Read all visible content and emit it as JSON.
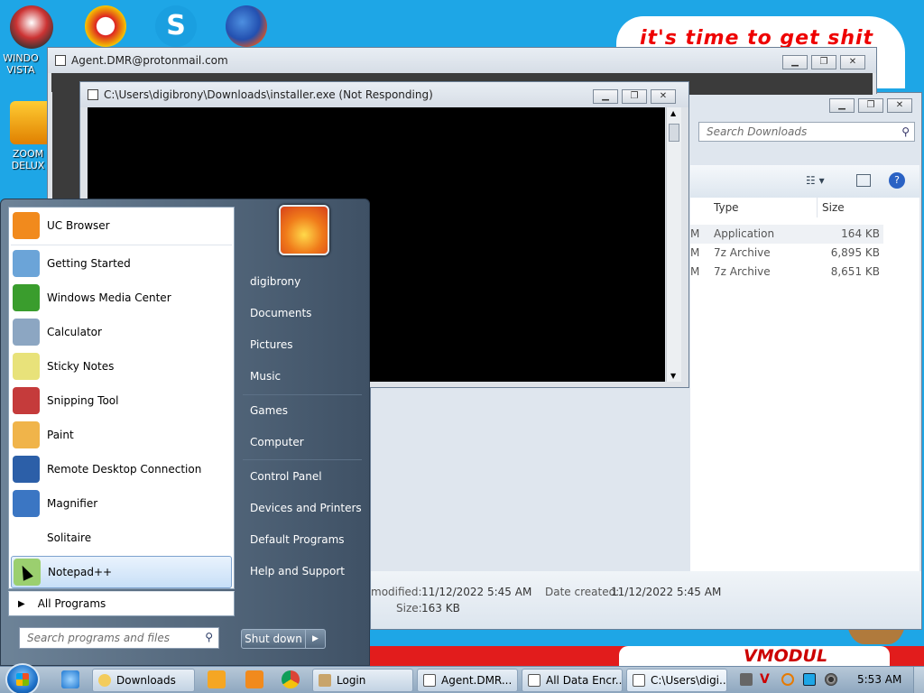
{
  "desktop": {
    "icons": [
      {
        "label": "WINDO VISTA"
      },
      {
        "label": "ZOOM DELUX"
      }
    ],
    "wallpaper_text_top": "it's time to get shit",
    "wallpaper_text_bottom": "VMODUL"
  },
  "windows": {
    "email": {
      "title": "Agent.DMR@protonmail.com"
    },
    "installer": {
      "title": "C:\\Users\\digibrony\\Downloads\\installer.exe (Not Responding)"
    },
    "explorer": {
      "search_placeholder": "Search Downloads",
      "columns": {
        "type": "Type",
        "size": "Size"
      },
      "rows": [
        {
          "time_suffix": "M",
          "type": "Application",
          "size": "164 KB"
        },
        {
          "time_suffix": "M",
          "type": "7z Archive",
          "size": "6,895 KB"
        },
        {
          "time_suffix": "M",
          "type": "7z Archive",
          "size": "8,651 KB"
        }
      ],
      "details": {
        "modified_label": "modified:",
        "modified_value": "11/12/2022 5:45 AM",
        "created_label": "Date created:",
        "created_value": "11/12/2022 5:45 AM",
        "size_label": "Size:",
        "size_value": "163 KB"
      }
    }
  },
  "start_menu": {
    "programs": [
      {
        "label": "UC Browser",
        "icon": "uc-browser-icon",
        "color": "#f18a1d"
      },
      {
        "label": "Getting Started",
        "icon": "getting-started-icon",
        "color": "#6ba4d8"
      },
      {
        "label": "Windows Media Center",
        "icon": "media-center-icon",
        "color": "#3a9d2d"
      },
      {
        "label": "Calculator",
        "icon": "calculator-icon",
        "color": "#8ca6c2"
      },
      {
        "label": "Sticky Notes",
        "icon": "sticky-notes-icon",
        "color": "#e8e27a"
      },
      {
        "label": "Snipping Tool",
        "icon": "snipping-tool-icon",
        "color": "#c53b3b"
      },
      {
        "label": "Paint",
        "icon": "paint-icon",
        "color": "#f0b44a"
      },
      {
        "label": "Remote Desktop Connection",
        "icon": "remote-desktop-icon",
        "color": "#2c5fa8"
      },
      {
        "label": "Magnifier",
        "icon": "magnifier-icon",
        "color": "#3b76c3"
      },
      {
        "label": "Solitaire",
        "icon": "",
        "color": ""
      },
      {
        "label": "Notepad++",
        "icon": "notepad-plus-plus-icon",
        "color": "#9bcf6f"
      }
    ],
    "all_programs": "All Programs",
    "search_placeholder": "Search programs and files",
    "right_links": [
      "digibrony",
      "Documents",
      "Pictures",
      "Music",
      "Games",
      "Computer",
      "Control Panel",
      "Devices and Printers",
      "Default Programs",
      "Help and Support"
    ],
    "shutdown": "Shut down"
  },
  "taskbar": {
    "buttons": [
      {
        "label": "Downloads"
      },
      {
        "label": "Login"
      },
      {
        "label": "Agent.DMR..."
      },
      {
        "label": "All Data Encr..."
      },
      {
        "label": "C:\\Users\\digi..."
      }
    ],
    "clock": "5:53 AM"
  }
}
